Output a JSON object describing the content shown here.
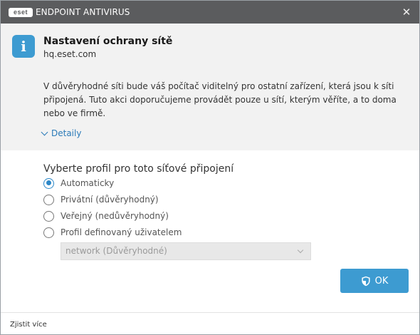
{
  "titlebar": {
    "logo_text": "eset",
    "product_name": "ENDPOINT ANTIVIRUS",
    "close_symbol": "✕"
  },
  "info": {
    "icon": "info-icon",
    "icon_glyph": "i",
    "title": "Nastavení ochrany sítě",
    "host": "hq.eset.com",
    "description": "V důvěryhodné síti bude váš počítač viditelný pro ostatní zařízení, která jsou k síti připojená. Tuto akci doporučujeme provádět pouze u sítí, kterým věříte, a to doma nebo ve firmě.",
    "details_label": "Detaily"
  },
  "profile": {
    "section_title": "Vyberte profil pro toto síťové připojení",
    "options": [
      {
        "label": "Automaticky",
        "checked": true
      },
      {
        "label": "Privátní (důvěryhodný)",
        "checked": false
      },
      {
        "label": "Veřejný (nedůvěryhodný)",
        "checked": false
      },
      {
        "label": "Profil definovaný uživatelem",
        "checked": false
      }
    ],
    "select_value": "network (Důvěryhodné)",
    "select_enabled": false
  },
  "actions": {
    "ok_label": "OK",
    "ok_icon": "shield-icon"
  },
  "footer": {
    "learn_more": "Zjistit více"
  },
  "colors": {
    "titlebar_bg": "#5b5c5e",
    "accent": "#3d9bd1",
    "link": "#2a7ab8",
    "panel_bg": "#f2f2f2"
  }
}
